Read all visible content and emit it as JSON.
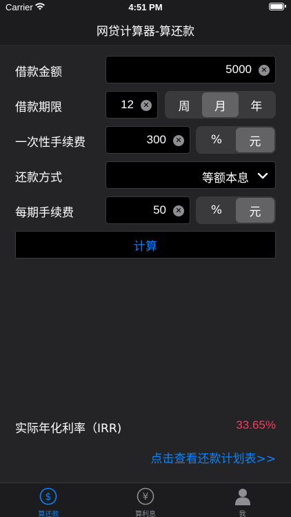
{
  "status_bar": {
    "carrier": "Carrier",
    "time": "4:51 PM"
  },
  "nav": {
    "title": "网贷计算器-算还款"
  },
  "form": {
    "amount": {
      "label": "借款金额",
      "value": "5000"
    },
    "term": {
      "label": "借款期限",
      "value": "12",
      "units": [
        "周",
        "月",
        "年"
      ],
      "selected": "月"
    },
    "one_time_fee": {
      "label": "一次性手续费",
      "value": "300",
      "units": [
        "%",
        "元"
      ],
      "selected": "元"
    },
    "method": {
      "label": "还款方式",
      "value": "等额本息"
    },
    "period_fee": {
      "label": "每期手续费",
      "value": "50",
      "units": [
        "%",
        "元"
      ],
      "selected": "元"
    }
  },
  "calc_button": "计算",
  "result": {
    "label": "实际年化利率（IRR)",
    "value": "33.65%"
  },
  "schedule_link": "点击查看还款计划表>>",
  "tabs": [
    {
      "label": "算还款",
      "icon": "dollar-circle-icon",
      "active": true
    },
    {
      "label": "算利息",
      "icon": "yen-circle-icon",
      "active": false
    },
    {
      "label": "我",
      "icon": "person-icon",
      "active": false
    }
  ],
  "colors": {
    "accent": "#0a84ff",
    "result": "#ff375f"
  }
}
